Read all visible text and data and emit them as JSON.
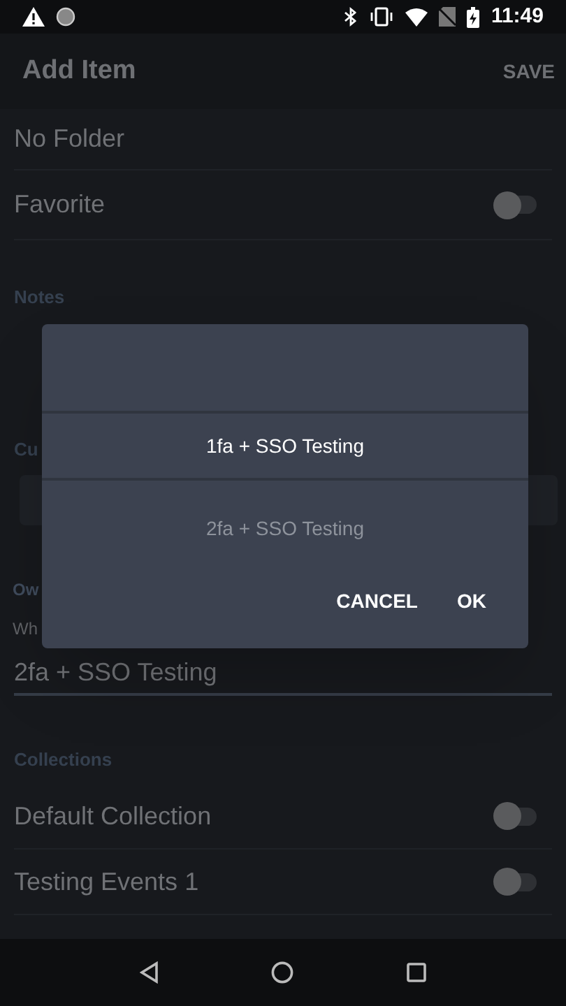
{
  "status_bar": {
    "time": "11:49"
  },
  "app_bar": {
    "title": "Add Item",
    "action": "SAVE"
  },
  "form": {
    "folder_value": "No Folder",
    "favorite": {
      "label": "Favorite",
      "on": false
    },
    "notes_header": "Notes",
    "custom_header": "Cu",
    "owner_header": "Ow",
    "owner_prompt": "Wh",
    "owner_value": "2fa + SSO Testing",
    "collections_header": "Collections",
    "collections": [
      {
        "label": "Default Collection",
        "on": false
      },
      {
        "label": "Testing Events 1",
        "on": false
      }
    ]
  },
  "dialog": {
    "options": [
      {
        "label": "1fa + SSO Testing",
        "selected": true
      },
      {
        "label": "2fa + SSO Testing",
        "selected": false
      }
    ],
    "buttons": [
      "CANCEL",
      "OK"
    ]
  }
}
